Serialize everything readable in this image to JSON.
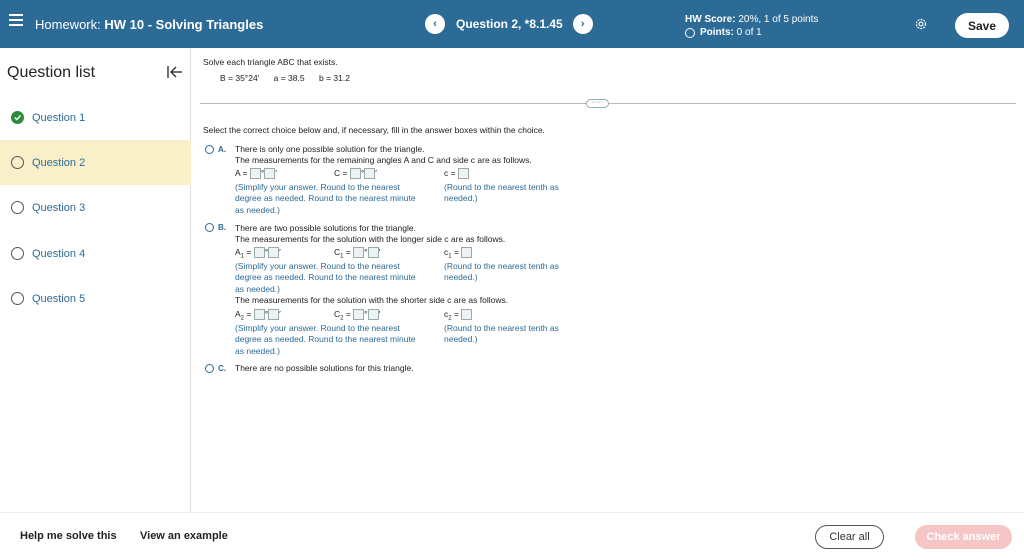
{
  "header": {
    "homework_prefix": "Homework:",
    "homework_title": "HW 10 - Solving Triangles",
    "question_label": "Question 2, *8.1.45",
    "prev_symbol": "‹",
    "next_symbol": "›",
    "score_label": "HW Score:",
    "score_value": "20%, 1 of 5 points",
    "points_label": "Points:",
    "points_value": "0 of 1",
    "save_label": "Save"
  },
  "sidebar": {
    "title": "Question list",
    "items": [
      {
        "label": "Question 1",
        "status": "complete"
      },
      {
        "label": "Question 2",
        "status": "current"
      },
      {
        "label": "Question 3",
        "status": "open"
      },
      {
        "label": "Question 4",
        "status": "open"
      },
      {
        "label": "Question 5",
        "status": "open"
      }
    ]
  },
  "question": {
    "prompt": "Solve each triangle ABC that exists.",
    "given_B": "B = 35°24′",
    "given_a": "a = 38.5",
    "given_b": "b = 31.2",
    "more_label": "·····",
    "instruction": "Select the correct choice below and, if necessary, fill in the answer boxes within the choice."
  },
  "choices": {
    "a": {
      "letter": "A.",
      "text": "There is only one possible solution for the triangle.",
      "sub": "The measurements for the remaining angles A and C and side c are as follows.",
      "A_label": "A =",
      "C_label": "C =",
      "c_label": "c =",
      "hint_angle": "(Simplify your answer. Round to the nearest\ndegree as needed. Round to the nearest minute\nas needed.)",
      "hint_side": "(Round to the nearest tenth as\nneeded.)"
    },
    "b": {
      "letter": "B.",
      "text": "There are two possible solutions for the triangle.",
      "sub1": "The measurements for the solution with the longer side c are as follows.",
      "A1_label": "A",
      "C1_label": "C",
      "c1_label": "c",
      "sub_index1": "1",
      "hint_angle1": "(Simplify your answer. Round to the nearest\ndegree as needed. Round to the nearest minute\nas needed.)",
      "hint_side1": "(Round to the nearest tenth as\nneeded.)",
      "sub2": "The measurements for the solution with the shorter side c are as follows.",
      "A2_label": "A",
      "C2_label": "C",
      "c2_label": "c",
      "sub_index2": "2",
      "hint_angle2": "(Simplify your answer. Round to the nearest\ndegree as needed. Round to the nearest minute\nas needed.)",
      "hint_side2": "(Round to the nearest tenth as\nneeded.)"
    },
    "c": {
      "letter": "C.",
      "text": "There are no possible solutions for this triangle."
    }
  },
  "footer": {
    "help_label": "Help me solve this",
    "example_label": "View an example",
    "clear_label": "Clear all",
    "check_label": "Check answer"
  },
  "colors": {
    "header_bg": "#2d6b97",
    "active_row": "#f9f0c9",
    "complete_check": "#2e8b3e",
    "check_button": "#f6c5c5"
  }
}
